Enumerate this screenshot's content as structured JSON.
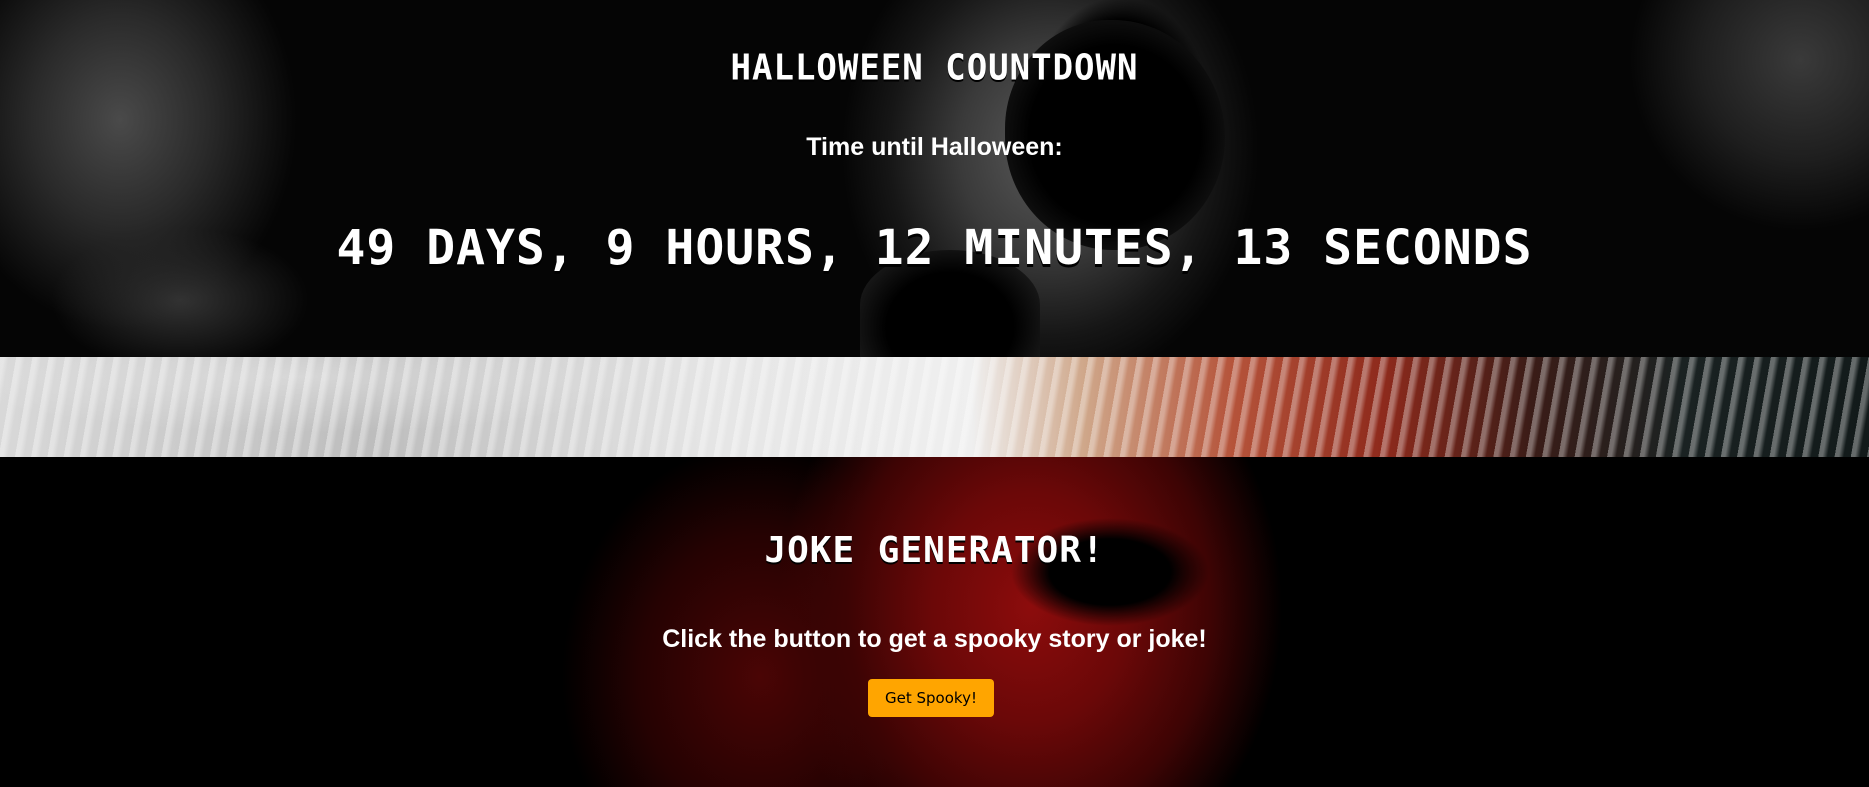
{
  "countdown": {
    "title": "Halloween Countdown",
    "subtitle": "Time until Halloween:",
    "time_remaining": "49 days, 9 hours, 12 minutes, 13 seconds"
  },
  "joke": {
    "title": "Joke Generator!",
    "subtitle": "Click the button to get a spooky story or joke!",
    "button_label": "Get Spooky!"
  },
  "colors": {
    "button_background": "#ffa500",
    "text": "#ffffff",
    "page_background": "#000000"
  }
}
